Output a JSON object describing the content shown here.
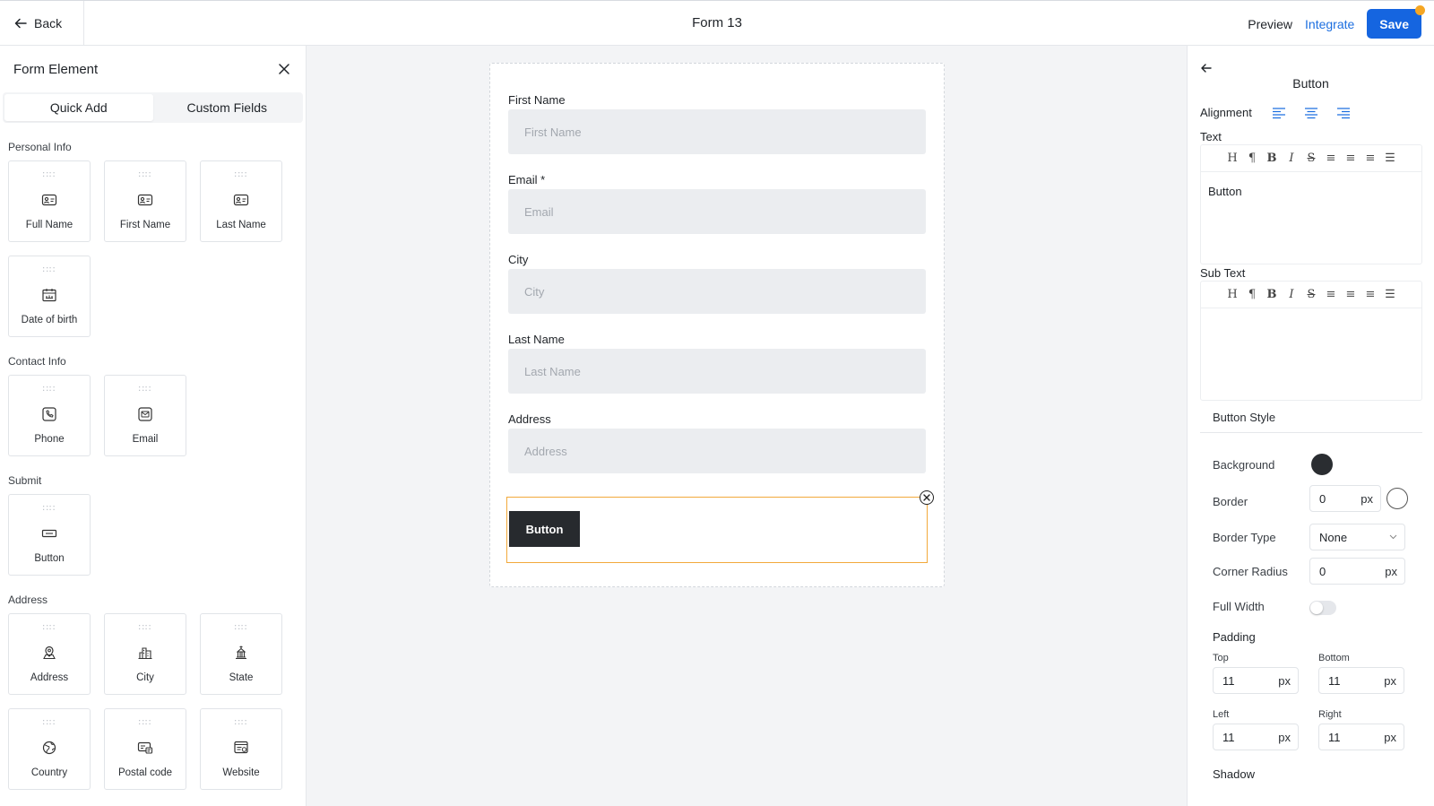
{
  "header": {
    "back_label": "Back",
    "title": "Form 13",
    "preview_label": "Preview",
    "integrate_label": "Integrate",
    "save_label": "Save",
    "accent_color": "#1565e0"
  },
  "left_panel": {
    "title": "Form Element",
    "tabs": [
      {
        "label": "Quick Add",
        "active": true
      },
      {
        "label": "Custom Fields",
        "active": false
      }
    ],
    "sections": {
      "personal": {
        "label": "Personal Info",
        "items": [
          {
            "label": "Full Name",
            "icon": "id-card-icon"
          },
          {
            "label": "First Name",
            "icon": "id-card-icon"
          },
          {
            "label": "Last Name",
            "icon": "id-card-icon"
          },
          {
            "label": "Date of birth",
            "icon": "calendar-icon"
          }
        ]
      },
      "contact": {
        "label": "Contact Info",
        "items": [
          {
            "label": "Phone",
            "icon": "phone-icon"
          },
          {
            "label": "Email",
            "icon": "envelope-icon"
          }
        ]
      },
      "submit": {
        "label": "Submit",
        "items": [
          {
            "label": "Button",
            "icon": "button-icon"
          }
        ]
      },
      "address": {
        "label": "Address",
        "items": [
          {
            "label": "Address",
            "icon": "map-pin-icon"
          },
          {
            "label": "City",
            "icon": "city-icon"
          },
          {
            "label": "State",
            "icon": "landmark-icon"
          },
          {
            "label": "Country",
            "icon": "globe-icon"
          },
          {
            "label": "Postal code",
            "icon": "postal-icon"
          },
          {
            "label": "Website",
            "icon": "web-icon"
          }
        ]
      }
    }
  },
  "form": {
    "fields": [
      {
        "label": "First Name",
        "placeholder": "First Name"
      },
      {
        "label": "Email *",
        "placeholder": "Email"
      },
      {
        "label": "City",
        "placeholder": "City"
      },
      {
        "label": "Last Name",
        "placeholder": "Last Name"
      },
      {
        "label": "Address",
        "placeholder": "Address"
      }
    ],
    "button_label": "Button",
    "selection_color": "#f2a93b"
  },
  "right_panel": {
    "title": "Button",
    "alignment_label": "Alignment",
    "text_label": "Text",
    "text_value": "Button",
    "subtext_label": "Sub Text",
    "subtext_value": "",
    "button_style_label": "Button Style",
    "background_label": "Background",
    "background_color": "#2a2d31",
    "border_label": "Border",
    "border_value": "0",
    "border_color": "#ffffff",
    "unit": "px",
    "border_type_label": "Border Type",
    "border_type_value": "None",
    "corner_radius_label": "Corner Radius",
    "corner_radius_value": "0",
    "full_width_label": "Full Width",
    "full_width_on": false,
    "padding_label": "Padding",
    "padding": {
      "top_label": "Top",
      "top": "11",
      "bottom_label": "Bottom",
      "bottom": "11",
      "left_label": "Left",
      "left": "11",
      "right_label": "Right",
      "right": "11"
    },
    "shadow_label": "Shadow"
  }
}
